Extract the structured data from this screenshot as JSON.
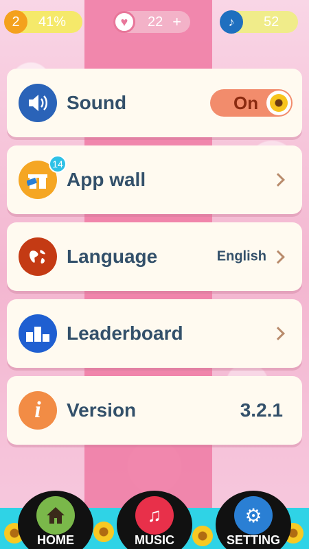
{
  "topbar": {
    "level": "2",
    "level_progress": "41%",
    "hearts": "22",
    "hearts_plus": "+",
    "notes": "52"
  },
  "settings": {
    "sound": {
      "label": "Sound",
      "toggle": "On"
    },
    "app_wall": {
      "label": "App wall",
      "badge": "14"
    },
    "language": {
      "label": "Language",
      "value": "English"
    },
    "leaderboard": {
      "label": "Leaderboard"
    },
    "version": {
      "label": "Version",
      "value": "3.2.1"
    }
  },
  "nav": {
    "home": "HOME",
    "music": "MUSIC",
    "setting": "SETTING"
  },
  "colors": {
    "background": "#f6c8dc",
    "card": "#fffaf0",
    "label_text": "#33506a",
    "toggle": "#f28c6c",
    "nav_bar": "#2fd3e6"
  }
}
